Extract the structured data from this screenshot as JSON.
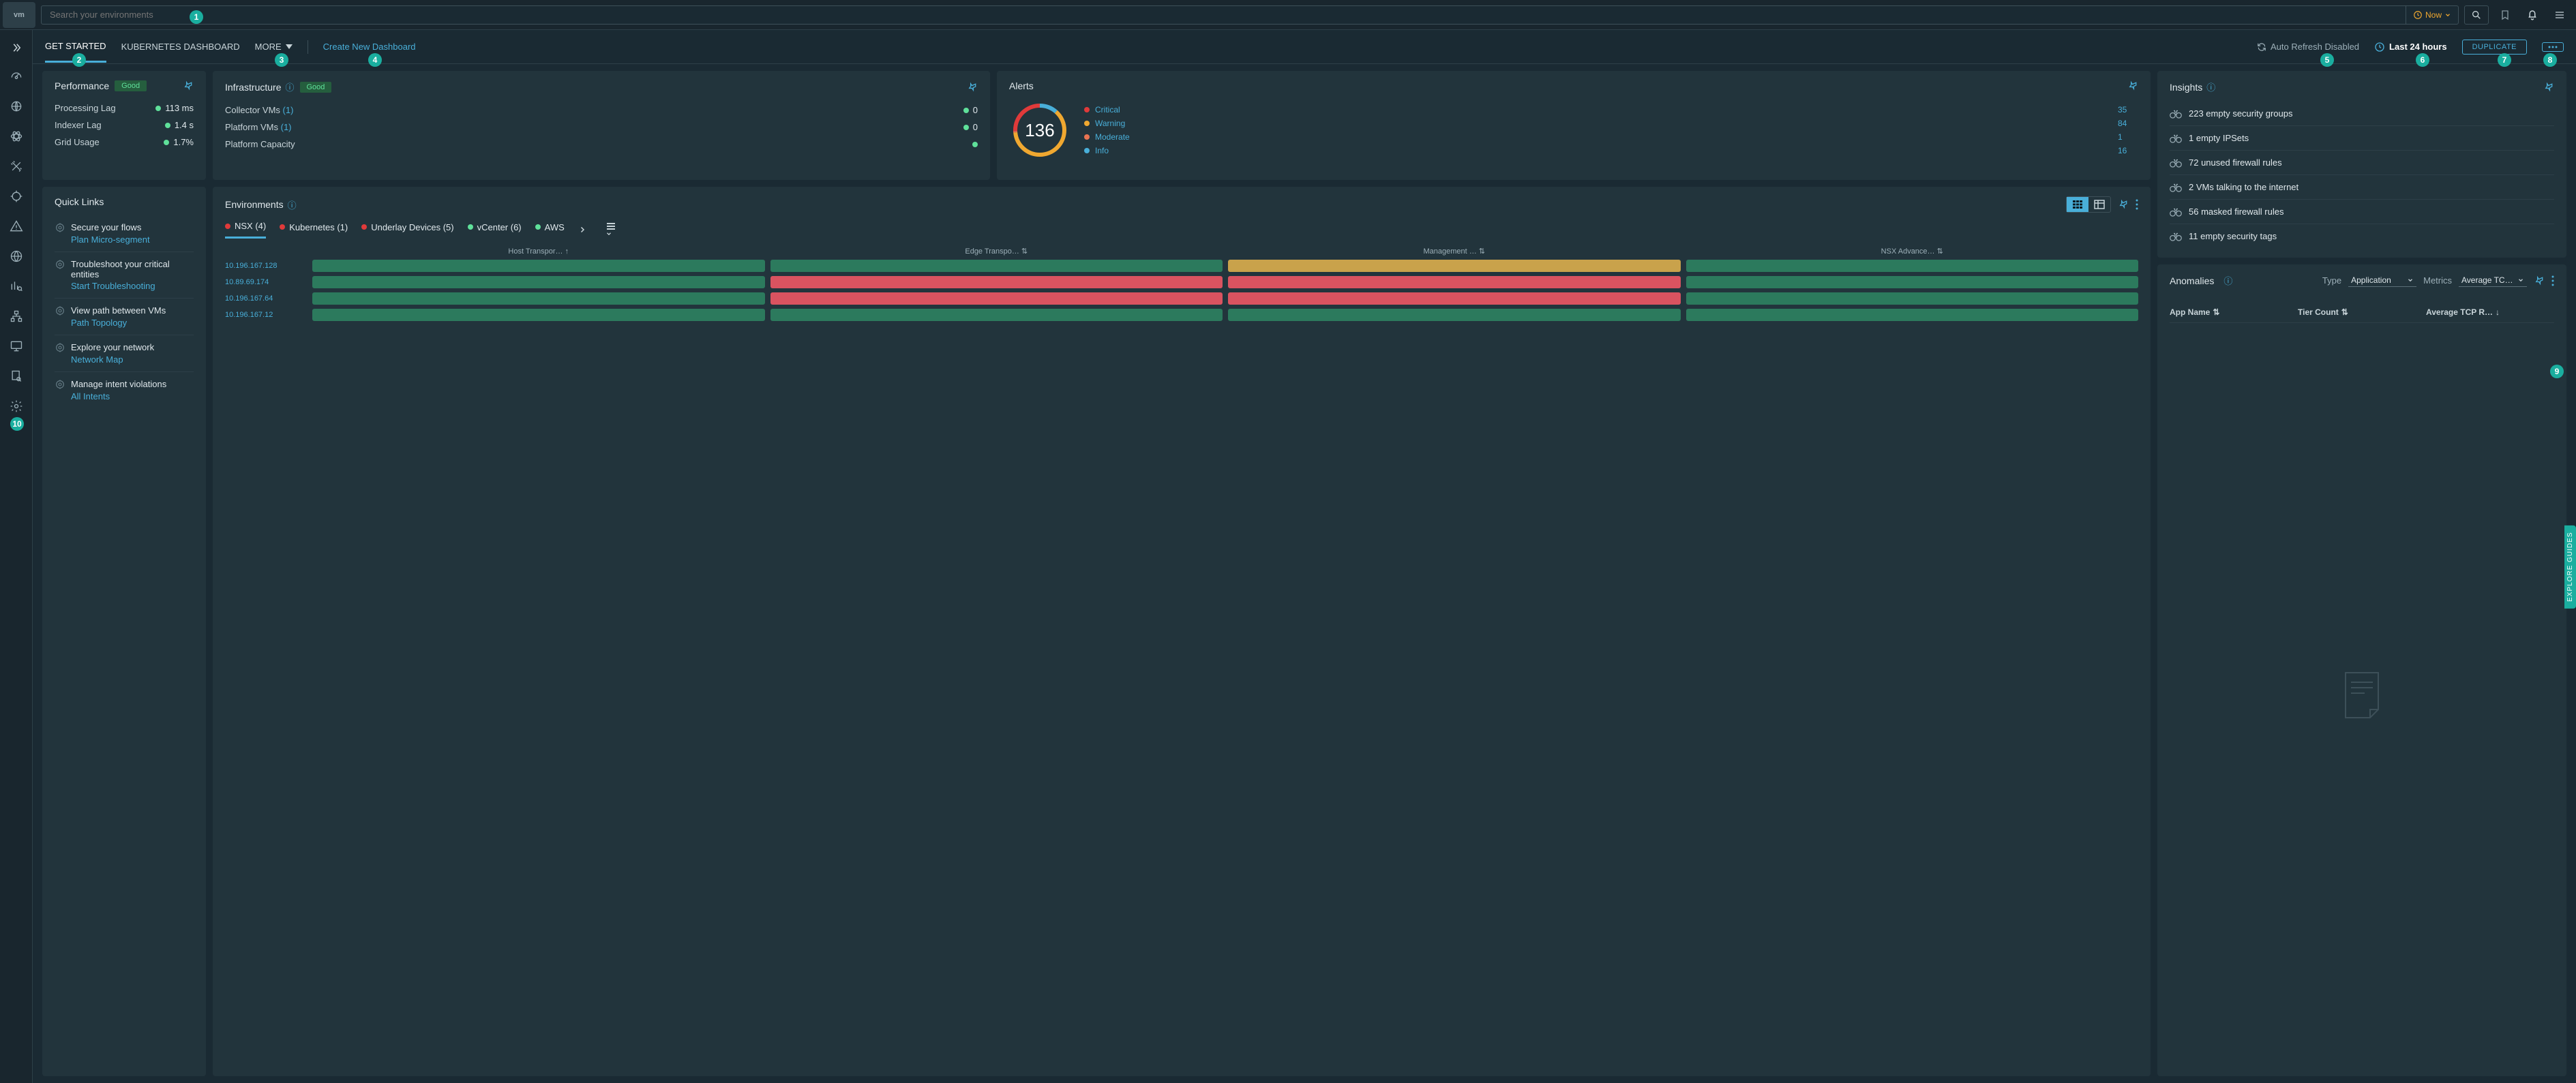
{
  "search": {
    "placeholder": "Search your environments"
  },
  "now": {
    "label": "Now"
  },
  "tabs": {
    "get_started": "GET STARTED",
    "kubernetes": "KUBERNETES DASHBOARD",
    "more": "MORE",
    "create": "Create New Dashboard"
  },
  "toolbar": {
    "auto_refresh": "Auto Refresh Disabled",
    "time_range": "Last 24 hours",
    "duplicate": "DUPLICATE"
  },
  "performance": {
    "title": "Performance",
    "status": "Good",
    "rows": [
      {
        "label": "Processing Lag",
        "value": "113 ms"
      },
      {
        "label": "Indexer Lag",
        "value": "1.4 s"
      },
      {
        "label": "Grid Usage",
        "value": "1.7%"
      }
    ]
  },
  "infrastructure": {
    "title": "Infrastructure",
    "status": "Good",
    "rows": [
      {
        "label": "Collector VMs",
        "count": "(1)",
        "value": "0"
      },
      {
        "label": "Platform VMs",
        "count": "(1)",
        "value": "0"
      },
      {
        "label": "Platform Capacity",
        "count": "",
        "value": ""
      }
    ]
  },
  "alerts": {
    "title": "Alerts",
    "total": "136",
    "items": [
      {
        "label": "Critical",
        "count": "35",
        "color": "#e03a3a"
      },
      {
        "label": "Warning",
        "count": "84",
        "color": "#f0a830"
      },
      {
        "label": "Moderate",
        "count": "1",
        "color": "#e87352"
      },
      {
        "label": "Info",
        "count": "16",
        "color": "#49afd9"
      }
    ]
  },
  "chart_data": {
    "type": "pie",
    "title": "Alerts",
    "categories": [
      "Critical",
      "Warning",
      "Moderate",
      "Info"
    ],
    "values": [
      35,
      84,
      1,
      16
    ],
    "colors": [
      "#e03a3a",
      "#f0a830",
      "#e87352",
      "#49afd9"
    ],
    "total": 136
  },
  "quicklinks": {
    "title": "Quick Links",
    "items": [
      {
        "title": "Secure your flows",
        "link": "Plan Micro-segment"
      },
      {
        "title": "Troubleshoot your critical entities",
        "link": "Start Troubleshooting"
      },
      {
        "title": "View path between VMs",
        "link": "Path Topology"
      },
      {
        "title": "Explore your network",
        "link": "Network Map"
      },
      {
        "title": "Manage intent violations",
        "link": "All Intents"
      }
    ]
  },
  "environments": {
    "title": "Environments",
    "tabs": [
      {
        "label": "NSX (4)",
        "color": "#e03a3a",
        "active": true
      },
      {
        "label": "Kubernetes (1)",
        "color": "#e03a3a"
      },
      {
        "label": "Underlay Devices (5)",
        "color": "#e03a3a"
      },
      {
        "label": "vCenter (6)",
        "color": "#5fe09a"
      },
      {
        "label": "AWS",
        "color": "#5fe09a"
      }
    ],
    "columns": [
      "Host Transpor…",
      "Edge Transpo…",
      "Management …",
      "NSX Advance…"
    ],
    "rows": [
      {
        "ip": "10.196.167.128",
        "cells": [
          "green",
          "green",
          "amber",
          "green"
        ]
      },
      {
        "ip": "10.89.69.174",
        "cells": [
          "green",
          "red",
          "red",
          "green"
        ]
      },
      {
        "ip": "10.196.167.64",
        "cells": [
          "green",
          "red",
          "red",
          "green"
        ]
      },
      {
        "ip": "10.196.167.12",
        "cells": [
          "green",
          "green",
          "green",
          "green"
        ]
      }
    ]
  },
  "insights": {
    "title": "Insights",
    "items": [
      "223 empty security groups",
      "1 empty IPSets",
      "72 unused firewall rules",
      "2 VMs talking to the internet",
      "56 masked firewall rules",
      "11 empty security tags"
    ]
  },
  "anomalies": {
    "title": "Anomalies",
    "type_label": "Type",
    "type_value": "Application",
    "metrics_label": "Metrics",
    "metrics_value": "Average TC…",
    "columns": [
      "App Name",
      "Tier Count",
      "Average TCP R…"
    ]
  },
  "explore_guides": "EXPLORE GUIDES",
  "callouts": [
    "1",
    "2",
    "3",
    "4",
    "5",
    "6",
    "7",
    "8",
    "9",
    "10"
  ]
}
